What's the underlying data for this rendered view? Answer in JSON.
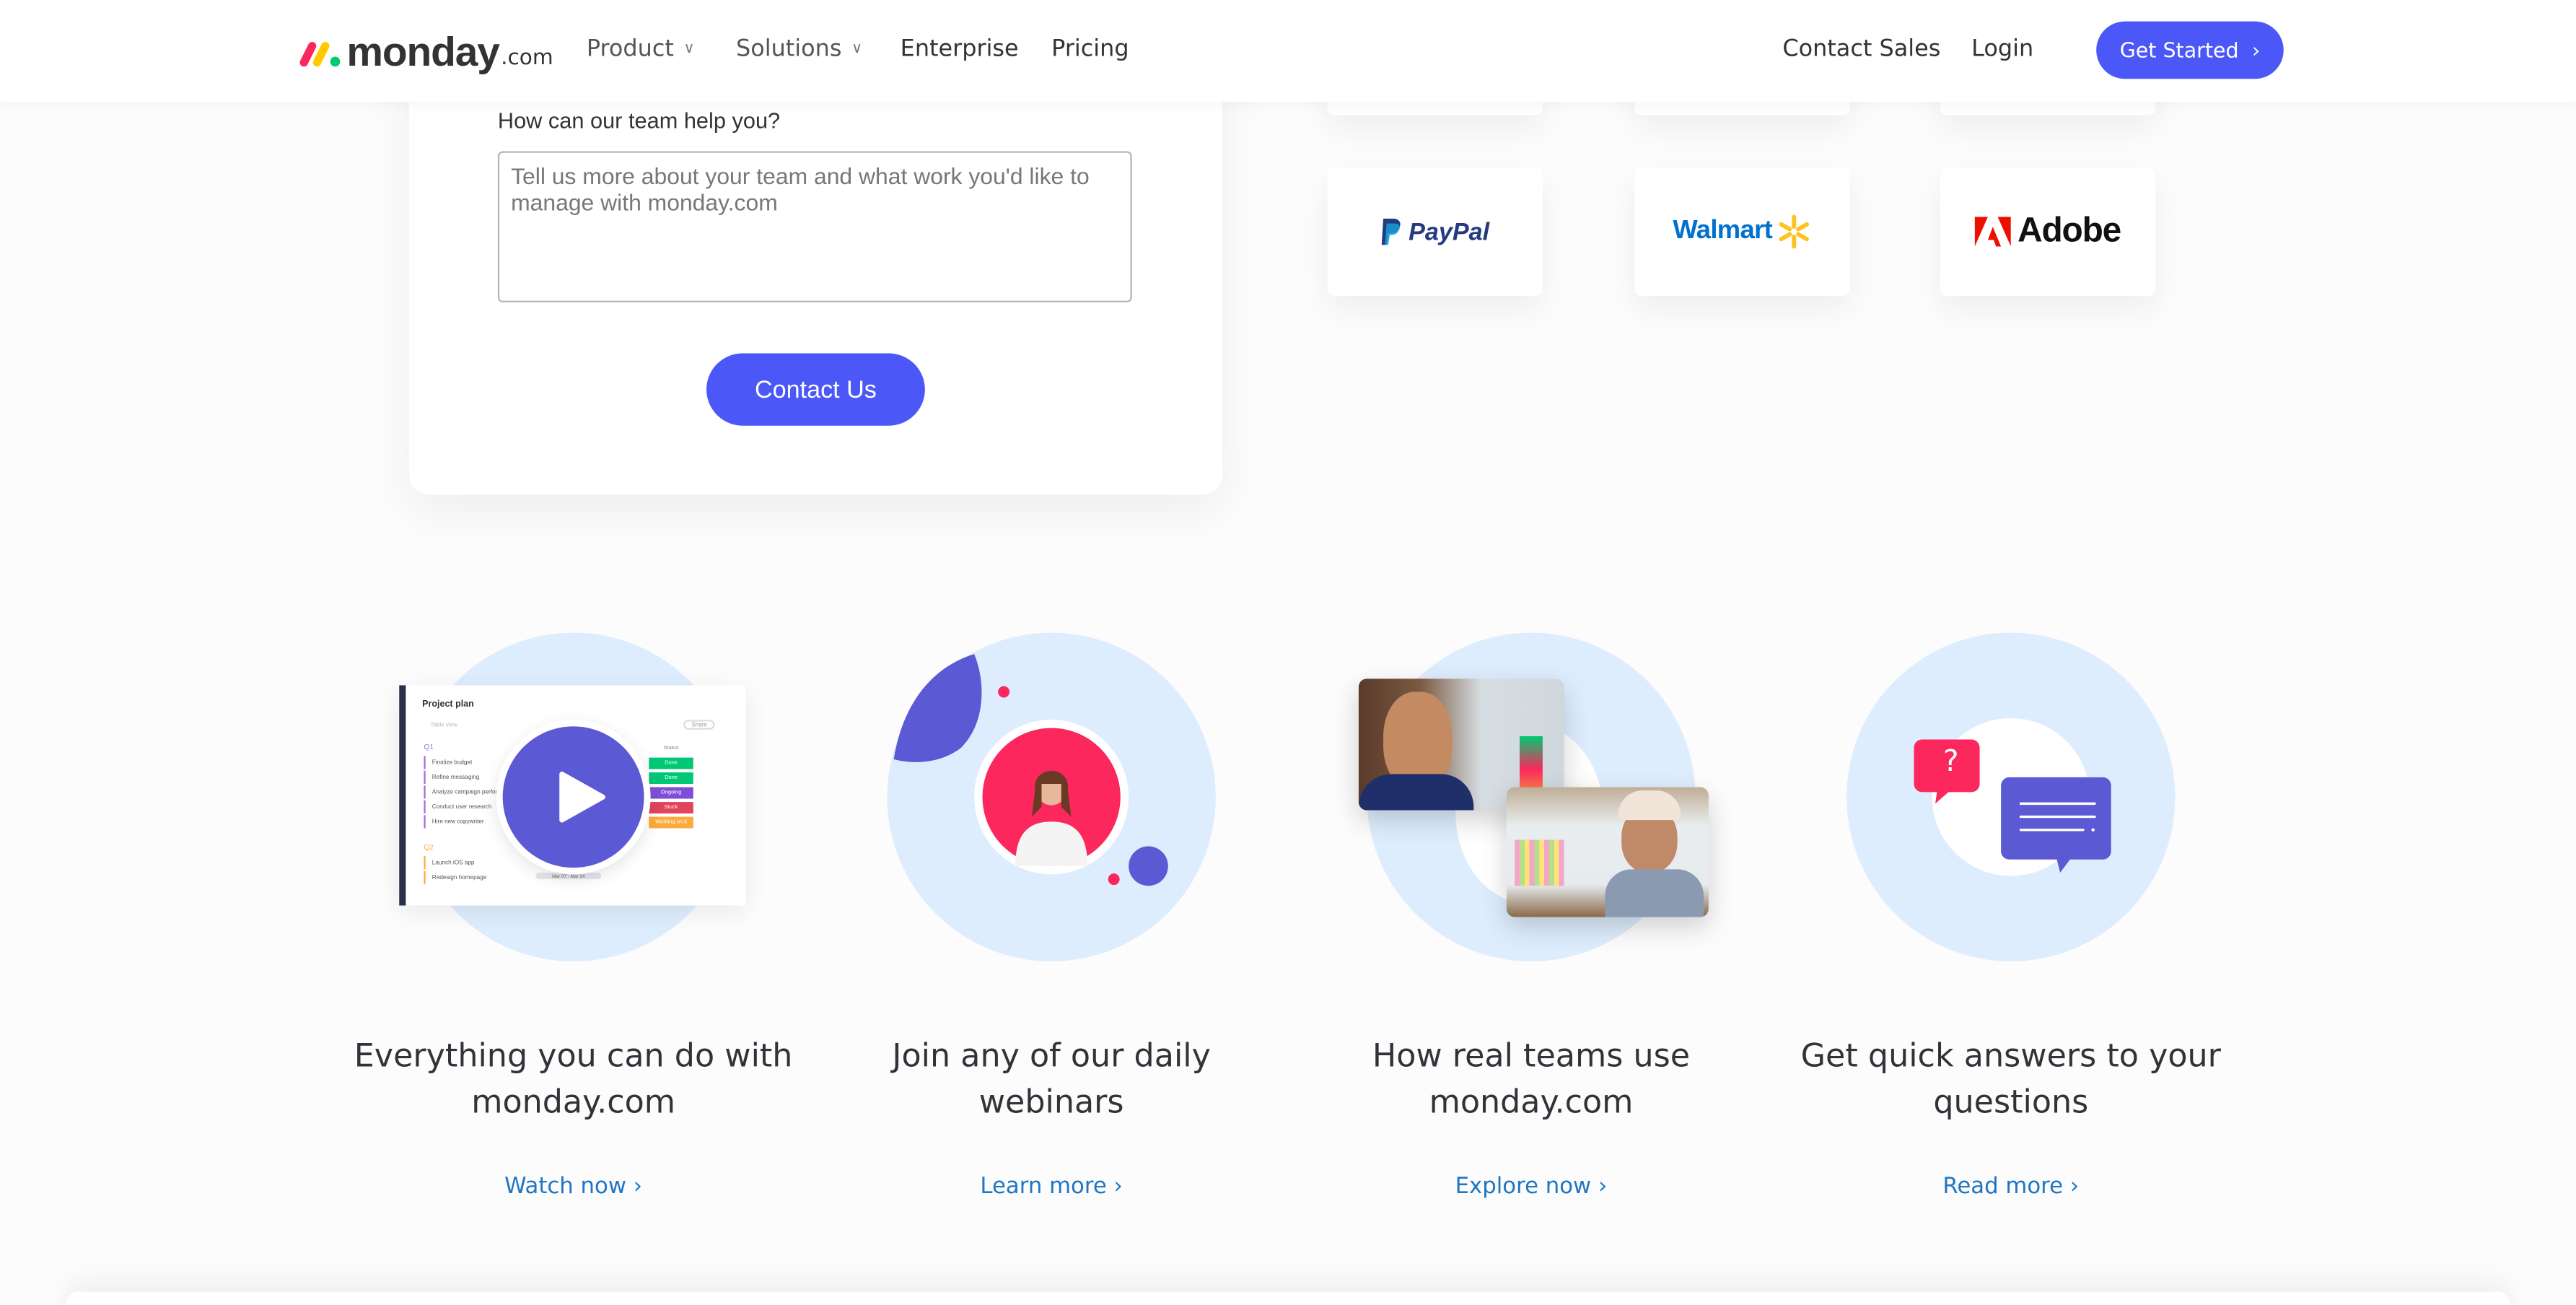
{
  "header": {
    "logo_word": "monday",
    "logo_suffix": ".com",
    "nav": [
      {
        "label": "Product",
        "has_dropdown": true
      },
      {
        "label": "Solutions",
        "has_dropdown": true
      },
      {
        "label": "Enterprise"
      },
      {
        "label": "Pricing"
      }
    ],
    "contact_sales": "Contact Sales",
    "login": "Login",
    "get_started": "Get Started",
    "accent_color": "#4b57f7"
  },
  "form": {
    "label": "How can our team help you?",
    "textarea_value": "",
    "textarea_placeholder": "Tell us more about your team and what work you'd like to manage with monday.com",
    "submit": "Contact Us"
  },
  "logos": [
    "PayPal",
    "Walmart",
    "Adobe"
  ],
  "board_preview": {
    "title": "Project plan",
    "view": "Table view",
    "share": "Share",
    "status_header": "Status",
    "groups": [
      {
        "name": "Q1",
        "items": [
          {
            "name": "Finalize budget",
            "status": "Done",
            "color": "#00c875"
          },
          {
            "name": "Refine messaging",
            "status": "Done",
            "color": "#00c875"
          },
          {
            "name": "Analyze campaign performan",
            "status": "Ongoing",
            "color": "#7e4fd6"
          },
          {
            "name": "Conduct user research",
            "status": "Stuck",
            "color": "#e2445c"
          },
          {
            "name": "Hire new copywriter",
            "status": "Working on it",
            "color": "#fdab3d"
          }
        ]
      },
      {
        "name": "Q2",
        "items": [
          {
            "name": "Launch iOS app"
          },
          {
            "name": "Redesign homepage",
            "date": "Mar 07 - Mar 24"
          }
        ]
      }
    ]
  },
  "resources": [
    {
      "title_line1": "Everything you can do with",
      "title_line2": "monday.com",
      "link": "Watch now"
    },
    {
      "title_line1": "Join any of our daily",
      "title_line2": "webinars",
      "link": "Learn more"
    },
    {
      "title_line1": "How real teams use",
      "title_line2": "monday.com",
      "link": "Explore now"
    },
    {
      "title_line1": "Get quick answers to your",
      "title_line2": "questions",
      "link": "Read more"
    }
  ],
  "help_bubble_mark": "?"
}
